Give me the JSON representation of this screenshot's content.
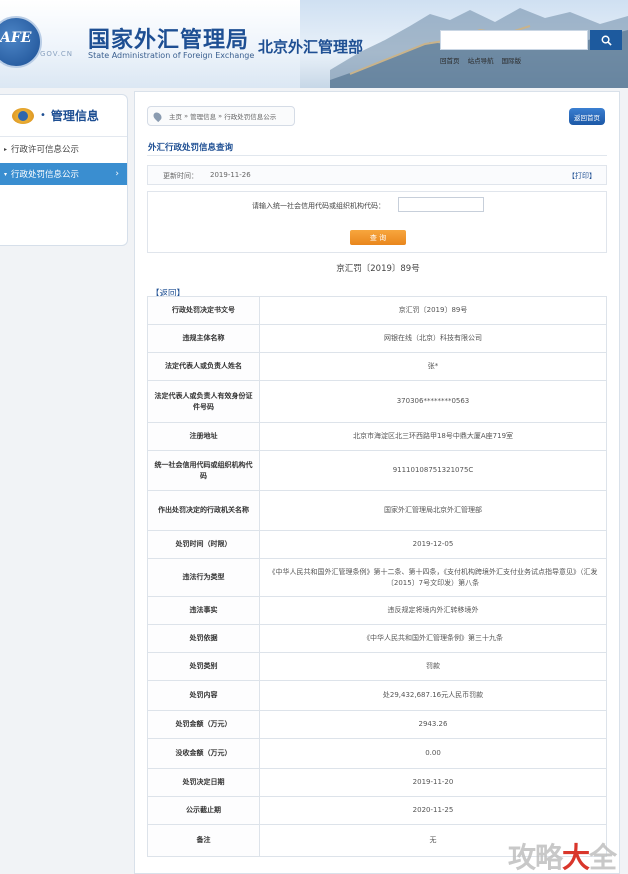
{
  "header": {
    "logo_text": "AFE",
    "logo_domain": "GOV.CN",
    "title_cn": "国家外汇管理局",
    "title_en": "State Administration of Foreign Exchange",
    "branch": "北京外汇管理部",
    "search_placeholder": "",
    "links": [
      "回首页",
      "站点导航",
      "国际版"
    ]
  },
  "sidebar": {
    "title": "管理信息",
    "items": [
      {
        "label": "行政许可信息公示",
        "active": false
      },
      {
        "label": "行政处罚信息公示",
        "active": true
      }
    ]
  },
  "breadcrumb": [
    "主页",
    "管理信息",
    "行政处罚信息公示"
  ],
  "back_home_label": "返回首页",
  "section_title": "外汇行政处罚信息查询",
  "update_label": "更新时间：",
  "update_date": "2019-11-26",
  "print_label": "【打印】",
  "query": {
    "label": "请输入统一社会信用代码或组织机构代码：",
    "value": "",
    "button": "查  询"
  },
  "doc_number": "京汇罚〔2019〕89号",
  "return_label": "【返回】",
  "rows": [
    {
      "key": "行政处罚决定书文号",
      "value": "京汇罚〔2019〕89号",
      "h": 28
    },
    {
      "key": "违规主体名称",
      "value": "网银在线（北京）科技有限公司",
      "h": 28
    },
    {
      "key": "法定代表人或负责人姓名",
      "value": "张*",
      "h": 28
    },
    {
      "key": "法定代表人或负责人有效身份证件号码",
      "value": "370306********0563",
      "h": 42
    },
    {
      "key": "注册地址",
      "value": "北京市海淀区北三环西路甲18号中鼎大厦A座719室",
      "h": 28
    },
    {
      "key": "统一社会信用代码或组织机构代码",
      "value": "91110108751321075C",
      "h": 40
    },
    {
      "key": "作出处罚决定的行政机关名称",
      "value": "国家外汇管理局北京外汇管理部",
      "h": 40
    },
    {
      "key": "处罚时间（时限）",
      "value": "2019-12-05",
      "h": 28
    },
    {
      "key": "违法行为类型",
      "value": "《中华人民共和国外汇管理条例》第十二条、第十四条，《支付机构跨境外汇支付业务试点指导意见》（汇发〔2015〕7号文印发）第八条",
      "h": 38
    },
    {
      "key": "违法事实",
      "value": "违反规定将境内外汇转移境外",
      "h": 28
    },
    {
      "key": "处罚依据",
      "value": "《中华人民共和国外汇管理条例》第三十九条",
      "h": 28
    },
    {
      "key": "处罚类别",
      "value": "罚款",
      "h": 28
    },
    {
      "key": "处罚内容",
      "value": "处29,432,687.16元人民币罚款",
      "h": 30
    },
    {
      "key": "处罚金额（万元）",
      "value": "2943.26",
      "h": 28
    },
    {
      "key": "没收金额（万元）",
      "value": "0.00",
      "h": 30
    },
    {
      "key": "处罚决定日期",
      "value": "2019-11-20",
      "h": 28
    },
    {
      "key": "公示截止期",
      "value": "2020-11-25",
      "h": 28
    },
    {
      "key": "备注",
      "value": "无",
      "h": 32
    }
  ],
  "watermark": {
    "part1": "攻略",
    "part2": "大",
    "part3": "全"
  },
  "colors": {
    "primary": "#1e4f93",
    "active": "#3a8ed0",
    "button": "#f0951f"
  }
}
